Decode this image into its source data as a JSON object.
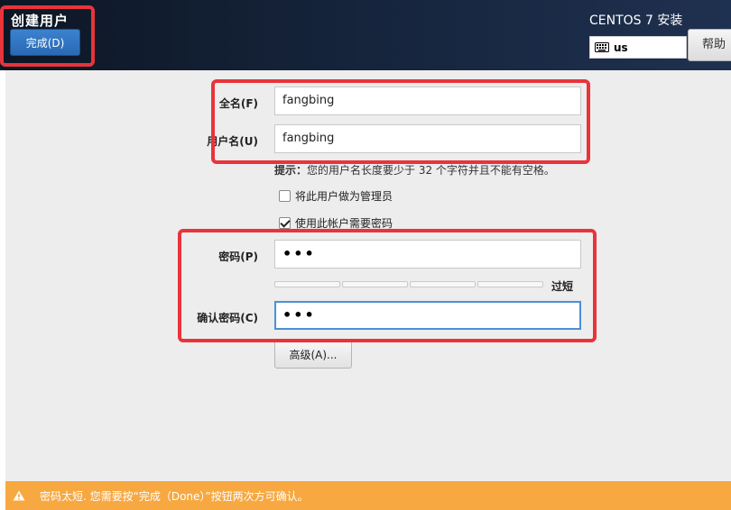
{
  "header": {
    "spoke_title": "创建用户",
    "done_label": "完成(D)",
    "install_title": "CENTOS 7 安装",
    "keyboard_layout": "us",
    "help_label": "帮助"
  },
  "form": {
    "fullname_label": "全名(F)",
    "fullname_value": "fangbing",
    "username_label": "用户名(U)",
    "username_value": "fangbing",
    "hint_bold": "提示：",
    "hint_text": "您的用户名长度要少于 32 个字符并且不能有空格。",
    "admin_label": "将此用户做为管理员",
    "admin_checked": false,
    "require_password_label": "使用此帐户需要密码",
    "require_password_checked": true,
    "password_label": "密码(P)",
    "password_value": "•••",
    "strength_label": "过短",
    "confirm_label": "确认密码(C)",
    "confirm_value": "•••",
    "advanced_label": "高级(A)..."
  },
  "warning": {
    "text": "密码太短. 您需要按“完成（Done）”按钮两次方可确认。"
  },
  "colors": {
    "accent_blue": "#3b82cf",
    "warning_orange": "#f7a840",
    "highlight_red": "#e8343a"
  }
}
